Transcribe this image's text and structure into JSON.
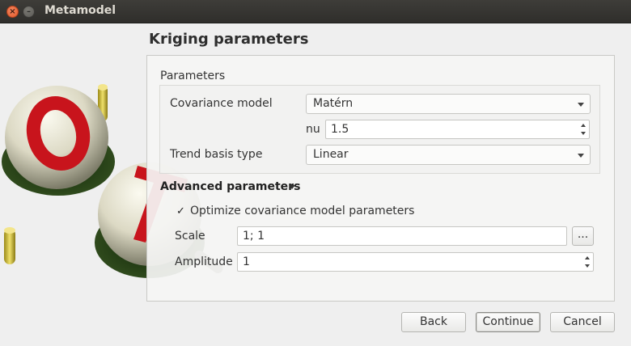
{
  "window": {
    "title": "Metamodel"
  },
  "page": {
    "heading": "Kriging parameters"
  },
  "parameters": {
    "group_label": "Parameters",
    "covariance_model": {
      "label": "Covariance model",
      "value": "Matérn"
    },
    "nu": {
      "label": "nu",
      "value": "1.5"
    },
    "trend_basis": {
      "label": "Trend basis type",
      "value": "Linear"
    }
  },
  "advanced": {
    "header": "Advanced parameters",
    "optimize": {
      "label": "Optimize covariance model parameters",
      "checked": true,
      "check_glyph": "✓"
    },
    "scale": {
      "label": "Scale",
      "value": "1; 1",
      "button": "..."
    },
    "amplitude": {
      "label": "Amplitude",
      "value": "1"
    }
  },
  "buttons": {
    "back": "Back",
    "continue": "Continue",
    "cancel": "Cancel"
  },
  "colors": {
    "logo_red": "#c8141c",
    "sphere": "#e9e6d6",
    "rod": "#d9c63a",
    "shadow": "#1d3a10"
  }
}
